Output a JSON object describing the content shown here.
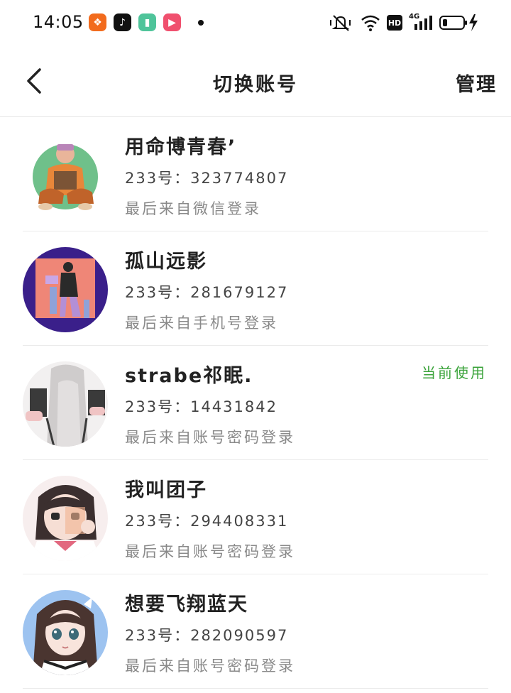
{
  "status_bar": {
    "time": "14:05",
    "apps": [
      {
        "name": "kuaishou-app-icon",
        "color": "#f26b1d",
        "glyph": "❖"
      },
      {
        "name": "tiktok-app-icon",
        "color": "#111111",
        "glyph": "♪"
      },
      {
        "name": "reader-app-icon",
        "color": "#4fc49a",
        "glyph": "▮"
      },
      {
        "name": "video-app-icon",
        "color": "#f0506e",
        "glyph": "▶"
      }
    ],
    "network_label": "4G",
    "hd_label": "HD"
  },
  "header": {
    "title": "切换账号",
    "manage_label": "管理"
  },
  "accounts": [
    {
      "name": "用命博青春’",
      "uid": "233号：323774807",
      "last_login": "最后来自微信登录",
      "current": false,
      "avatar_bg": "#6fc08a"
    },
    {
      "name": "孤山远影",
      "uid": "233号：281679127",
      "last_login": "最后来自手机号登录",
      "current": false,
      "avatar_bg": "#3a1f8a"
    },
    {
      "name": "strabe祁眠.",
      "uid": "233号：14431842",
      "last_login": "最后来自账号密码登录",
      "current": true,
      "current_label": "当前使用",
      "avatar_bg": "#e9e6e6"
    },
    {
      "name": "我叫团子",
      "uid": "233号：294408331",
      "last_login": "最后来自账号密码登录",
      "current": false,
      "avatar_bg": "#f3e9ea"
    },
    {
      "name": "想要飞翔蓝天",
      "uid": "233号：282090597",
      "last_login": "最后来自账号密码登录",
      "current": false,
      "avatar_bg": "#9dc3f0"
    }
  ]
}
